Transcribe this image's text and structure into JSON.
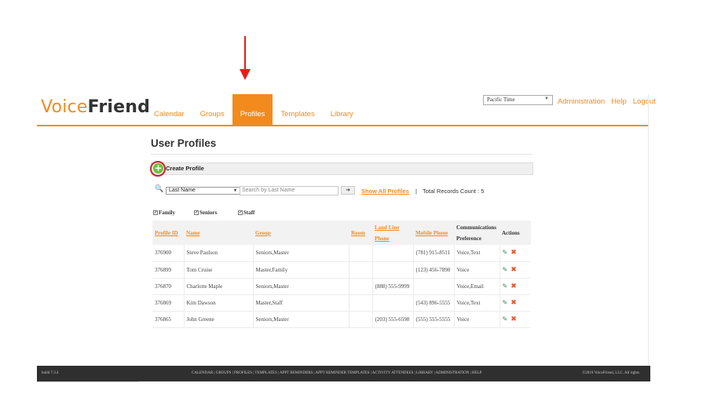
{
  "header": {
    "logo_voice": "Voice",
    "logo_friend": "Friend",
    "nav": [
      {
        "label": "Calendar"
      },
      {
        "label": "Groups"
      },
      {
        "label": "Profiles"
      },
      {
        "label": "Templates"
      },
      {
        "label": "Library"
      }
    ],
    "timezone": "Pacific Time",
    "links": {
      "admin": "Administration",
      "help": "Help",
      "logout": "Logout"
    }
  },
  "page": {
    "title": "User Profiles",
    "create_label": "Create Profile",
    "plus_glyph": "+",
    "search_field": "Last Name",
    "search_placeholder": "Search by Last Name",
    "show_all": "Show All Profiles",
    "separator": "|",
    "total": "Total Records Count : 5",
    "filters": {
      "family": "Family",
      "seniors": "Seniors",
      "staff": "Staff"
    }
  },
  "table": {
    "headers": {
      "profile_id": "Profile ID",
      "name": "Name",
      "group": "Group",
      "room": "Room",
      "land_line_1": "Land Line",
      "land_line_2": "Phone",
      "mobile": "Mobile Phone",
      "comm_1": "Communications",
      "comm_2": "Preference",
      "actions": "Actions"
    },
    "rows": [
      {
        "id": "376900",
        "name": "Steve Paulson",
        "group": "Seniors,Master",
        "room": "",
        "land": "",
        "mobile": "(781) 915-8511",
        "pref": "Voice,Text"
      },
      {
        "id": "376899",
        "name": "Tom Cruise",
        "group": "Master,Family",
        "room": "",
        "land": "",
        "mobile": "(123) 456-7890",
        "pref": "Voice"
      },
      {
        "id": "376870",
        "name": "Charlotte Maple",
        "group": "Seniors,Master",
        "room": "",
        "land": "(888) 555-9999",
        "mobile": "",
        "pref": "Voice,Email"
      },
      {
        "id": "376869",
        "name": "Kim Dawson",
        "group": "Master,Staff",
        "room": "",
        "land": "",
        "mobile": "(543) 896-5555",
        "pref": "Voice,Text"
      },
      {
        "id": "376865",
        "name": "John Greene",
        "group": "Seniors,Master",
        "room": "",
        "land": "(203) 555-6598",
        "mobile": "(555) 555-5555",
        "pref": "Voice"
      }
    ]
  },
  "footer": {
    "build": "build 7.3.4",
    "links": "CALENDAR | GROUPS | PROFILES | TEMPLATES | APPT REMINDERS | APPT REMINDER TEMPLATES | ACTIVITY ATTENDEES | LIBRARY | ADMINISTRATION | HELP",
    "copyright": "©2019 VoiceFriend, LLC. All rights"
  },
  "colors": {
    "accent": "#f28a1e",
    "annotation": "#e0201b",
    "add": "#6cbf3a",
    "footer": "#2f2f2f"
  },
  "icons": {
    "add": "plus-circle-icon",
    "search": "user-search-icon",
    "edit": "pencil-icon",
    "delete": "x-icon",
    "annotation": "arrow-down-icon"
  }
}
